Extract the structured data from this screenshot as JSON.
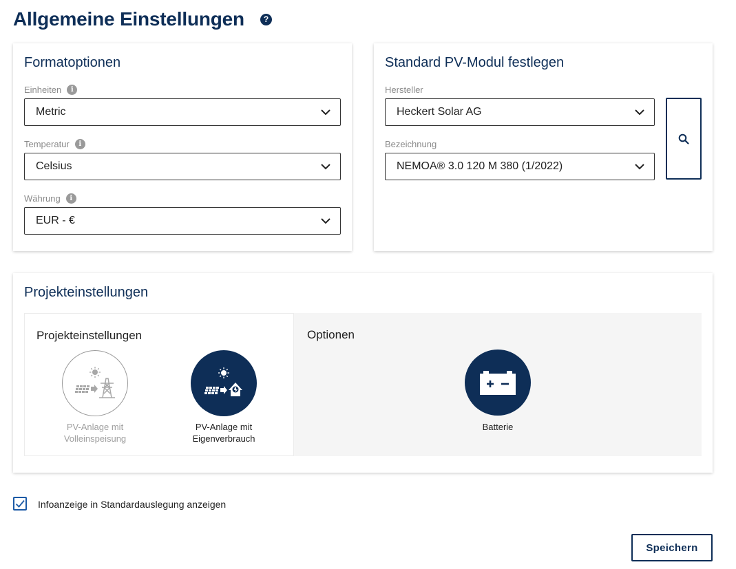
{
  "page": {
    "title": "Allgemeine Einstellungen",
    "help": "?"
  },
  "format_options": {
    "title": "Formatoptionen",
    "fields": [
      {
        "label": "Einheiten",
        "value": "Metric"
      },
      {
        "label": "Temperatur",
        "value": "Celsius"
      },
      {
        "label": "Währung",
        "value": "EUR - €"
      }
    ]
  },
  "pv_module": {
    "title": "Standard PV-Modul festlegen",
    "manufacturer": {
      "label": "Hersteller",
      "value": "Heckert Solar AG"
    },
    "designation": {
      "label": "Bezeichnung",
      "value": "NEMOA® 3.0 120 M 380 (1/2022)"
    }
  },
  "project_settings": {
    "title": "Projekteinstellungen",
    "left": {
      "title": "Projekteinstellungen",
      "options": [
        {
          "line1": "PV-Anlage mit",
          "line2": "Volleinspeisung",
          "selected": false
        },
        {
          "line1": "PV-Anlage mit",
          "line2": "Eigenverbrauch",
          "selected": true
        }
      ]
    },
    "right": {
      "title": "Optionen",
      "options": [
        {
          "label": "Batterie",
          "selected": true
        }
      ]
    }
  },
  "info_checkbox": {
    "label": "Infoanzeige in Standardauslegung anzeigen",
    "checked": true
  },
  "save_label": "Speichern",
  "colors": {
    "primary": "#0e2e57",
    "checkbox": "#1b5aa6",
    "muted": "#8a8a8a"
  }
}
